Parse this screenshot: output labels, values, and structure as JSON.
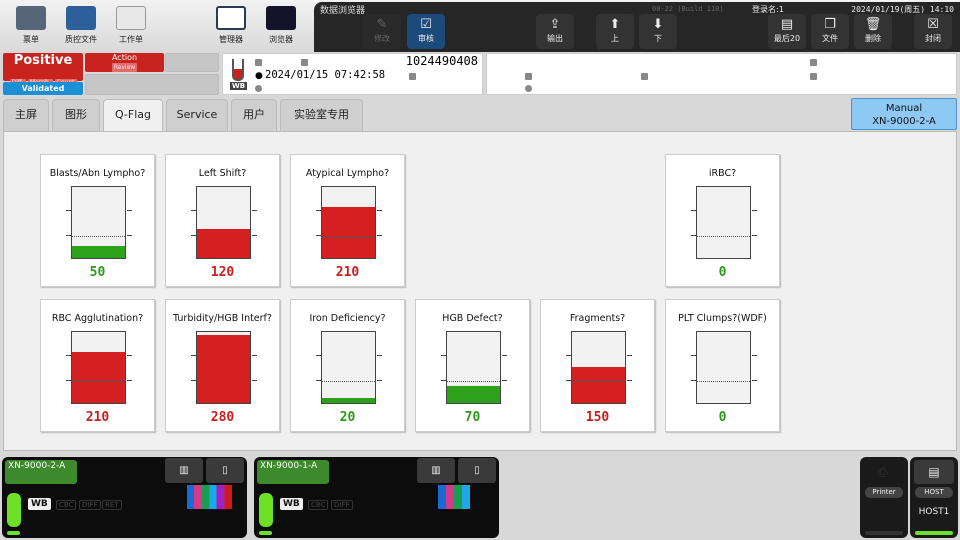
{
  "toolbar": {
    "items": [
      {
        "label": "票单",
        "icon": "grid-icon"
      },
      {
        "label": "质控文件",
        "icon": "folder-chart-icon"
      },
      {
        "label": "工作单",
        "icon": "worksheet-icon"
      },
      {
        "label": "管理器",
        "icon": "clipboard-search-icon"
      },
      {
        "label": "浏览器",
        "icon": "scatter-browser-icon"
      }
    ]
  },
  "viewer": {
    "title": "数据浏览器",
    "build": "00-22 (Build 110)",
    "login": "登录名:1",
    "datetime": "2024/01/19(周五) 14:10",
    "buttons": [
      {
        "label": "修改",
        "icon": "edit-icon",
        "disabled": true
      },
      {
        "label": "审核",
        "icon": "checkbox-icon",
        "active": true
      },
      {
        "label": "输出",
        "icon": "export-icon"
      },
      {
        "label": "上",
        "icon": "arrow-up-icon"
      },
      {
        "label": "下",
        "icon": "arrow-down-icon"
      },
      {
        "label": "最后20",
        "icon": "last20-icon"
      },
      {
        "label": "文件",
        "icon": "file-icon"
      },
      {
        "label": "删除",
        "icon": "trash-icon"
      },
      {
        "label": "封闭",
        "icon": "close-icon"
      }
    ]
  },
  "status": {
    "result": "Positive",
    "subflags": [
      "Diff.",
      "Morph.",
      "Count"
    ],
    "validated": "Validated",
    "action": "Action",
    "action_sub": "Review"
  },
  "sample": {
    "type": "WB",
    "number": "1024490408",
    "datetime": "2024/01/15 07:42:58"
  },
  "tabs": [
    {
      "label": "主屏"
    },
    {
      "label": "图形"
    },
    {
      "label": "Q-Flag",
      "active": true
    },
    {
      "label": "Service"
    },
    {
      "label": "用户"
    },
    {
      "label": "实验室专用"
    }
  ],
  "mode": {
    "line1": "Manual",
    "line2": "XN-9000-2-A"
  },
  "colors": {
    "red": "#d42020",
    "green": "#2ea11a",
    "red_text": "#c81e1e",
    "green_text": "#2a9a18"
  },
  "qflag_scale": {
    "max": 300,
    "threshold": 100,
    "ticks": [
      100,
      200
    ]
  },
  "qflags": [
    {
      "name": "Blasts/Abn Lympho?",
      "value": 50
    },
    {
      "name": "Left Shift?",
      "value": 120
    },
    {
      "name": "Atypical Lympho?",
      "value": 210
    },
    {
      "name": "iRBC?",
      "value": 0
    },
    {
      "name": "RBC Agglutination?",
      "value": 210
    },
    {
      "name": "Turbidity/HGB Interf?",
      "value": 280
    },
    {
      "name": "Iron Deficiency?",
      "value": 20
    },
    {
      "name": "HGB Defect?",
      "value": 70
    },
    {
      "name": "Fragments?",
      "value": 150
    },
    {
      "name": "PLT Clumps?(WDF)",
      "value": 0
    }
  ],
  "instruments": [
    {
      "name": "XN-9000-2-A",
      "modes": [
        "WB",
        "CBC",
        "DIFF",
        "RET"
      ]
    },
    {
      "name": "XN-9000-1-A",
      "modes": [
        "WB",
        "CBC",
        "DIFF"
      ]
    }
  ],
  "printer": {
    "label": "Printer"
  },
  "host": {
    "label": "HOST",
    "name": "HOST1"
  }
}
